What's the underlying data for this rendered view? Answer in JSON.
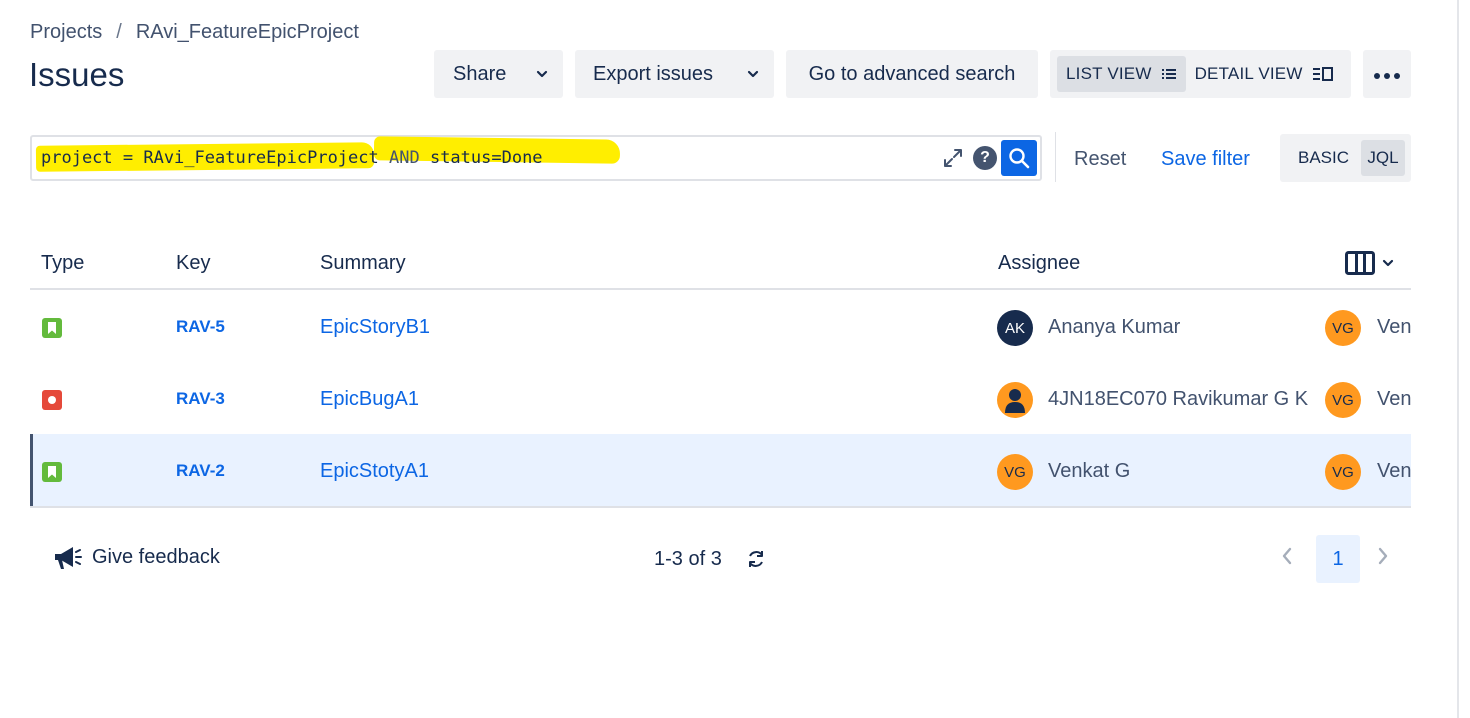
{
  "breadcrumb": {
    "root": "Projects",
    "separator": "/",
    "project": "RAvi_FeatureEpicProject"
  },
  "page_title": "Issues",
  "toolbar": {
    "share_label": "Share",
    "export_label": "Export issues",
    "advanced_search_label": "Go to advanced search",
    "list_view_label": "LIST VIEW",
    "detail_view_label": "DETAIL VIEW",
    "more_icon": "more-icon"
  },
  "search": {
    "query_part1": "project = RAvi_FeatureEpicProject ",
    "query_part2": "AND",
    "query_part3": " status=Done",
    "highlight_color": "#ffee00",
    "reset_label": "Reset",
    "save_filter_label": "Save filter",
    "basic_label": "BASIC",
    "jql_label": "JQL",
    "help_glyph": "?"
  },
  "table": {
    "headers": {
      "type": "Type",
      "key": "Key",
      "summary": "Summary",
      "assignee": "Assignee"
    },
    "rows": [
      {
        "type": "story",
        "key": "RAV-5",
        "summary": "EpicStoryB1",
        "assignee_initials": "AK",
        "assignee": "Ananya Kumar",
        "reporter_initials": "VG",
        "reporter": "Ven"
      },
      {
        "type": "bug",
        "key": "RAV-3",
        "summary": "EpicBugA1",
        "assignee_initials": "",
        "assignee": "4JN18EC070 Ravikumar G K",
        "reporter_initials": "VG",
        "reporter": "Ven"
      },
      {
        "type": "story",
        "key": "RAV-2",
        "summary": "EpicStotyA1",
        "assignee_initials": "VG",
        "assignee": "Venkat G",
        "reporter_initials": "VG",
        "reporter": "Ven",
        "selected": true
      }
    ]
  },
  "footer": {
    "feedback_label": "Give feedback",
    "count_text": "1-3 of 3",
    "current_page": "1"
  },
  "colors": {
    "link": "#0c66e4",
    "story": "#63ba3c",
    "bug": "#e5493a",
    "avatar_orange": "#ff991f",
    "avatar_dark": "#172b4d",
    "selected_row": "#e9f2ff"
  }
}
